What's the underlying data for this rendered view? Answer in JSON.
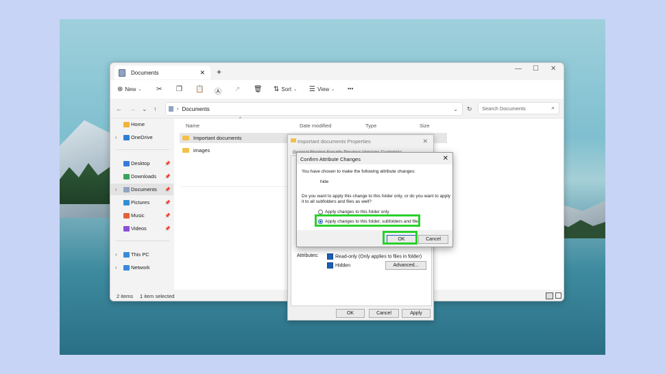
{
  "explorer": {
    "tab_title": "Documents",
    "toolbar": {
      "new_label": "New",
      "sort_label": "Sort",
      "view_label": "View",
      "more_label": "•••"
    },
    "address": "Documents",
    "search_placeholder": "Search Documents",
    "sidebar": [
      {
        "label": "Home",
        "expandable": false,
        "pinned": false
      },
      {
        "label": "OneDrive",
        "expandable": true,
        "pinned": false
      },
      {
        "label": "Desktop",
        "expandable": false,
        "pinned": true
      },
      {
        "label": "Downloads",
        "expandable": false,
        "pinned": true
      },
      {
        "label": "Documents",
        "expandable": true,
        "pinned": true,
        "selected": true
      },
      {
        "label": "Pictures",
        "expandable": false,
        "pinned": true
      },
      {
        "label": "Music",
        "expandable": false,
        "pinned": true
      },
      {
        "label": "Videos",
        "expandable": false,
        "pinned": true
      },
      {
        "label": "This PC",
        "expandable": true,
        "pinned": false
      },
      {
        "label": "Network",
        "expandable": true,
        "pinned": false
      }
    ],
    "columns": {
      "name": "Name",
      "date": "Date modified",
      "type": "Type",
      "size": "Size"
    },
    "files": [
      {
        "name": "Important documents",
        "selected": true
      },
      {
        "name": "images",
        "selected": false
      }
    ],
    "status": {
      "items": "2 items",
      "selected": "1 item selected"
    }
  },
  "properties": {
    "title": "Important documents Properties",
    "tabs": "General   Sharing   Security   Previous Versions   Customize",
    "attributes_label": "Attributes:",
    "readonly_label": "Read-only (Only applies to files in folder)",
    "hidden_label": "Hidden",
    "advanced_label": "Advanced...",
    "ok_label": "OK",
    "cancel_label": "Cancel",
    "apply_label": "Apply"
  },
  "confirm": {
    "title": "Confirm Attribute Changes",
    "intro": "You have chosen to make the following attribute changes:",
    "change": "hide",
    "question_line1": "Do you want to apply this change to this folder only, or do you want to apply",
    "question_line2": "it to all subfolders and files as well?",
    "option1": "Apply changes to this folder only",
    "option2": "Apply changes to this folder, subfolders and files",
    "ok_label": "OK",
    "cancel_label": "Cancel"
  },
  "colors": {
    "highlight": "#28d12a",
    "accent": "#1c5fb5"
  }
}
